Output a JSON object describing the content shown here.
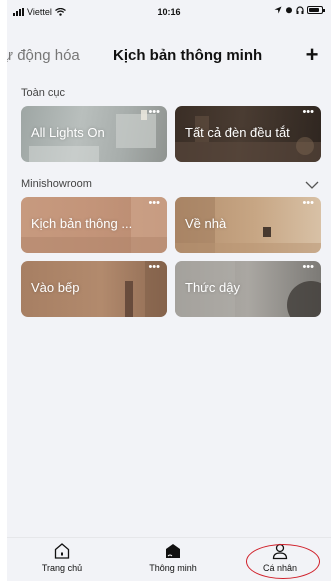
{
  "status_bar": {
    "carrier": "Viettel",
    "time": "10:16"
  },
  "header": {
    "tab_automation": "ự động hóa",
    "tab_smart": "Kịch bản thông minh",
    "add_label": "+"
  },
  "sections": {
    "global": {
      "label": "Toàn cục",
      "cards": [
        {
          "name": "All Lights On",
          "more": "•••"
        },
        {
          "name": "Tất cả đèn đều tắt",
          "more": "•••"
        }
      ]
    },
    "minishowroom": {
      "label": "Minishowroom",
      "cards": [
        {
          "name": "Kịch bản thông ...",
          "more": "•••"
        },
        {
          "name": "Về nhà",
          "more": "•••"
        },
        {
          "name": "Vào bếp",
          "more": "•••"
        },
        {
          "name": "Thức dậy",
          "more": "•••"
        }
      ]
    }
  },
  "bottom_nav": {
    "home": "Trang chủ",
    "smart": "Thông minh",
    "profile": "Cá nhân"
  },
  "colors": {
    "highlight": "#d0202a",
    "background": "#f2f3f7"
  },
  "icons": {
    "add": "plus-icon",
    "collapse": "chevron-down-icon",
    "home": "home-icon",
    "smart": "smart-scene-icon",
    "profile": "person-icon"
  }
}
